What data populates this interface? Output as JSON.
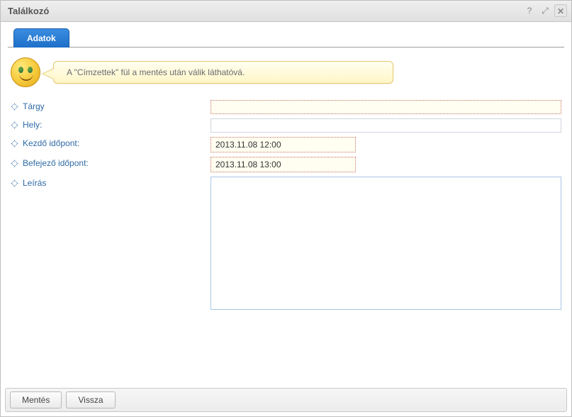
{
  "window": {
    "title": "Találkozó"
  },
  "tabs": {
    "data": "Adatok"
  },
  "notice": {
    "text": "A \"Címzettek\" fül a mentés után válik láthatóvá."
  },
  "form": {
    "subject_label": "Tárgy",
    "subject_value": "",
    "location_label": "Hely:",
    "location_value": "",
    "start_label": "Kezdő időpont:",
    "start_value": "2013.11.08 12:00",
    "end_label": "Befejező időpont:",
    "end_value": "2013.11.08 13:00",
    "desc_label": "Leírás",
    "desc_value": ""
  },
  "footer": {
    "save": "Mentés",
    "back": "Vissza"
  }
}
